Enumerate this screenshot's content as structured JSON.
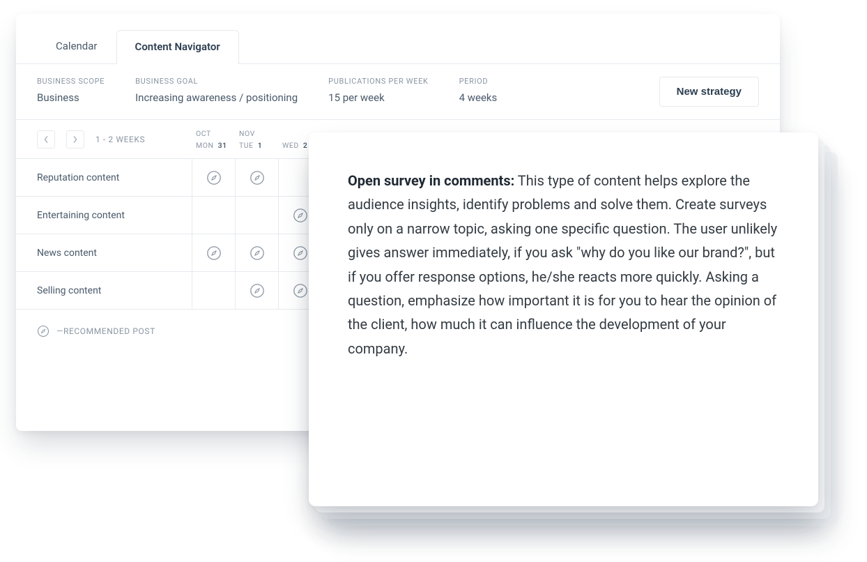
{
  "tabs": [
    {
      "label": "Calendar",
      "state": "inactive"
    },
    {
      "label": "Content Navigator",
      "state": "active"
    }
  ],
  "meta": {
    "scope_label": "BUSINESS SCOPE",
    "scope_value": "Business",
    "goal_label": "BUSINESS GOAL",
    "goal_value": "Increasing awareness / positioning",
    "ppw_label": "PUBLICATIONS PER WEEK",
    "ppw_value": "15 per week",
    "period_label": "PERIOD",
    "period_value": "4 weeks",
    "new_strategy": "New strategy"
  },
  "weeks_label": "1 - 2 WEEKS",
  "days": [
    {
      "month": "OCT",
      "dow": "MON",
      "num": "31"
    },
    {
      "month": "NOV",
      "dow": "TUE",
      "num": "1"
    },
    {
      "month": "",
      "dow": "WED",
      "num": "2"
    }
  ],
  "rows": [
    {
      "label": "Reputation content",
      "marks": [
        true,
        true,
        false
      ]
    },
    {
      "label": "Entertaining content",
      "marks": [
        false,
        false,
        true
      ]
    },
    {
      "label": "News content",
      "marks": [
        true,
        true,
        true
      ]
    },
    {
      "label": "Selling content",
      "marks": [
        false,
        true,
        true
      ]
    }
  ],
  "legend": {
    "text": "—RECOMMENDED POST"
  },
  "popover": {
    "title": "Open survey in comments:",
    "body": " This type of content helps explore the audience insights, identify problems and solve them. Create surveys only on a narrow topic, asking one specific question. The user unlikely gives answer immediately, if you ask \"why do you like our brand?\", but if you offer response options, he/she reacts more quickly. Asking a question, emphasize how important it is for you to hear the opinion of the client, how much it can influence the development of your company."
  }
}
